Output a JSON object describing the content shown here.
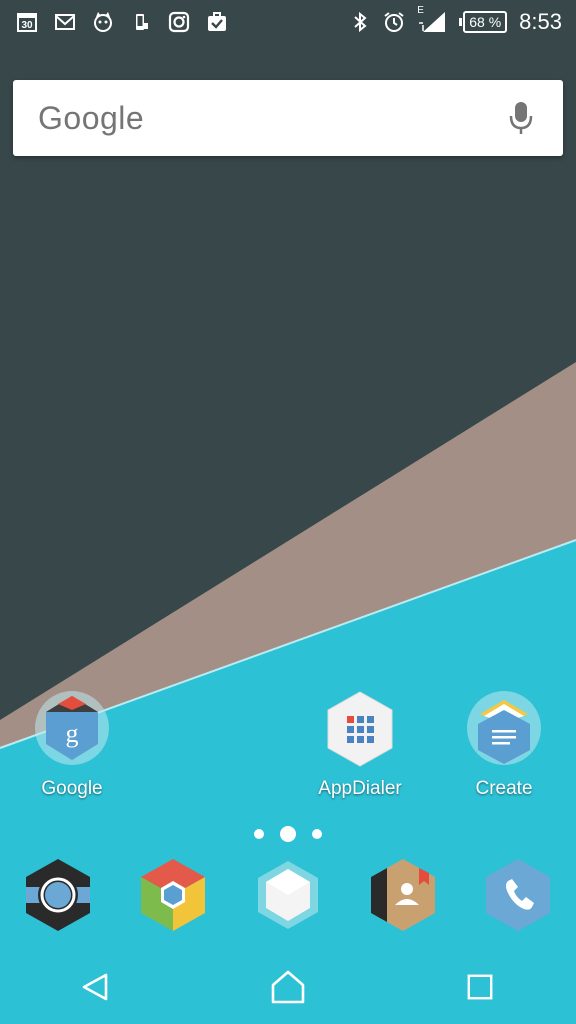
{
  "status_bar": {
    "calendar_day": "30",
    "network_type": "E",
    "battery_percent": "68 %",
    "time": "8:53",
    "left_icons": [
      "calendar-icon",
      "gmail-icon",
      "cat-notification-icon",
      "phone-sync-icon",
      "instagram-icon",
      "task-check-icon"
    ],
    "right_icons": [
      "bluetooth-icon",
      "alarm-icon",
      "signal-icon",
      "battery-icon"
    ]
  },
  "search": {
    "logo": "Google",
    "icon": "mic-icon"
  },
  "desktop_apps": [
    {
      "label": "Google",
      "icon": "google-hex-icon"
    },
    {
      "label": "AppDialer",
      "icon": "appdialer-grid-icon"
    },
    {
      "label": "Create",
      "icon": "create-doc-icon"
    }
  ],
  "page_indicator": {
    "pages": 3,
    "current": 2
  },
  "dock": [
    {
      "icon": "camera-icon"
    },
    {
      "icon": "chrome-icon"
    },
    {
      "icon": "app-drawer-icon"
    },
    {
      "icon": "contacts-icon"
    },
    {
      "icon": "phone-icon"
    }
  ],
  "nav": [
    "back-icon",
    "home-icon",
    "recents-icon"
  ],
  "colors": {
    "wallpaper_dark": "#37474a",
    "wallpaper_taupe": "#a38f85",
    "wallpaper_cyan": "#2dc1d5",
    "hex_blue": "#5b9ed1"
  }
}
